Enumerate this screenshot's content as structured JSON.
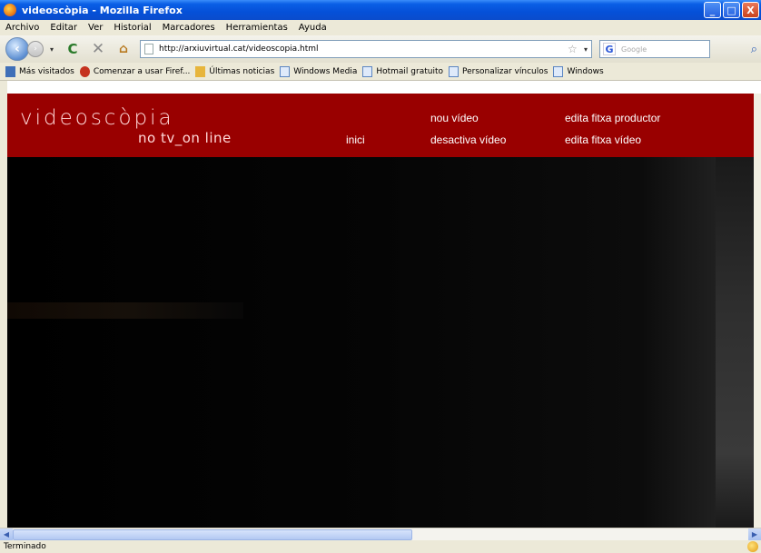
{
  "window": {
    "title": "videoscòpia - Mozilla Firefox",
    "buttons": {
      "minimize": "_",
      "maximize": "□",
      "close": "X"
    }
  },
  "menubar": {
    "items": [
      "Archivo",
      "Editar",
      "Ver",
      "Historial",
      "Marcadores",
      "Herramientas",
      "Ayuda"
    ]
  },
  "navbar": {
    "url": "http://arxiuvirtual.cat/videoscopia.html",
    "search_placeholder": "Google"
  },
  "bookmarks": {
    "items": [
      {
        "label": "Más visitados",
        "icon": "rss-icon"
      },
      {
        "label": "Comenzar a usar Firef...",
        "icon": "firefox-icon"
      },
      {
        "label": "Últimas noticias",
        "icon": "folder-icon"
      },
      {
        "label": "Windows Media",
        "icon": "page-icon"
      },
      {
        "label": "Hotmail gratuito",
        "icon": "page-icon"
      },
      {
        "label": "Personalizar vínculos",
        "icon": "page-icon"
      },
      {
        "label": "Windows",
        "icon": "page-icon"
      }
    ]
  },
  "site": {
    "logo_main": "videoscòpia",
    "logo_sub": "no tv_on line",
    "nav": {
      "inici": "inici",
      "nou_video": "nou vídeo",
      "desactiva_video": "desactiva vídeo",
      "edita_productor": "edita fitxa productor",
      "edita_video": "edita fitxa vídeo"
    },
    "header_color": "#990000"
  },
  "status": {
    "text": "Terminado"
  }
}
